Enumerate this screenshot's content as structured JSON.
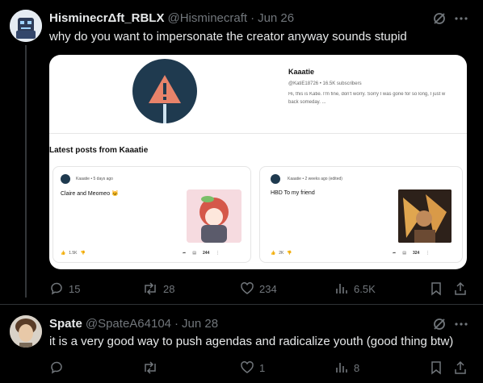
{
  "tweet1": {
    "display_name": "HisminecrΔft_RBLX",
    "handle": "@Hisminecraft",
    "date": "Jun 26",
    "text": "why do you want to impersonate the creator anyway sounds stupid",
    "stats": {
      "replies": "15",
      "retweets": "28",
      "likes": "234",
      "views": "6.5K"
    }
  },
  "embed": {
    "channel_name": "Kaaatie",
    "channel_meta": "@KatiE18726 • 16.5K subscribers",
    "channel_desc": "Hi, this is Katie. I'm fine, don't worry. Sorry I was gone for so long, I just w",
    "channel_desc2": "back someday. ...",
    "section_title": "Latest posts from Kaaatie",
    "posts": [
      {
        "author": "Kaaatie",
        "time": "5 days ago",
        "text": "Claire and Meomeo 🐱",
        "likes": "1.5K",
        "comments": "244"
      },
      {
        "author": "Kaaatie",
        "time": "2 weeks ago (edited)",
        "text": "HBD To my friend",
        "likes": "2K",
        "comments": "324"
      }
    ]
  },
  "tweet2": {
    "display_name": "Spate",
    "handle": "@SpateA64104",
    "date": "Jun 28",
    "text": "it is a very good way to push agendas and radicalize youth (good thing btw)",
    "stats": {
      "replies": "",
      "retweets": "",
      "likes": "1",
      "views": "8"
    }
  },
  "colors": {
    "background": "#000000",
    "text": "#e7e9ea",
    "muted": "#71767b",
    "divider": "#2f3336"
  }
}
